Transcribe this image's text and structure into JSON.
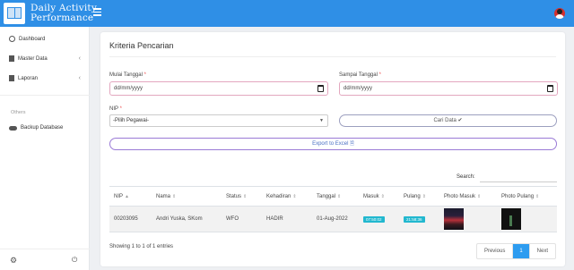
{
  "app": {
    "title_line1": "Daily Activity",
    "title_line2": "Performance"
  },
  "sidebar": {
    "items": [
      {
        "label": "Dashboard"
      },
      {
        "label": "Master Data"
      },
      {
        "label": "Laporan"
      }
    ],
    "section_label": "Others",
    "others": [
      {
        "label": "Backup Database"
      }
    ]
  },
  "page": {
    "title": "Kriteria Pencarian"
  },
  "form": {
    "start_label": "Mulai Tanggal",
    "start_value": "dd/mm/yyyy",
    "end_label": "Sampai Tanggal",
    "end_value": "dd/mm/yyyy",
    "required_mark": "*",
    "nip_label": "NIP",
    "nip_selected": "-Pilih Pegawai-",
    "search_button": "Cari Data",
    "search_icon": "✔",
    "export_button": "Export to Excel",
    "export_icon": "🗎"
  },
  "table": {
    "search_label": "Search:",
    "columns": [
      "NIP",
      "Nama",
      "Status",
      "Kehadiran",
      "Tanggal",
      "Masuk",
      "Pulang",
      "Photo Masuk",
      "Photo Pulang"
    ],
    "sort_icons": [
      "▲",
      "⇕",
      "⇕",
      "⇕",
      "⇕",
      "⇕",
      "⇕",
      "⇕",
      "⇕"
    ],
    "rows": [
      {
        "nip": "00203095",
        "nama": "Andri Yuska, SKom",
        "status": "WFO",
        "kehadiran": "HADIR",
        "tanggal": "01-Aug-2022",
        "masuk": "07:50:02",
        "pulang": "21:58:36"
      }
    ]
  },
  "footer": {
    "info": "Showing 1 to 1 of 1 entries",
    "prev": "Previous",
    "page": "1",
    "next": "Next"
  },
  "colors": {
    "topbar": "#2f8fe6",
    "badge": "#22b8cf",
    "active_page": "#2d9cf0"
  }
}
